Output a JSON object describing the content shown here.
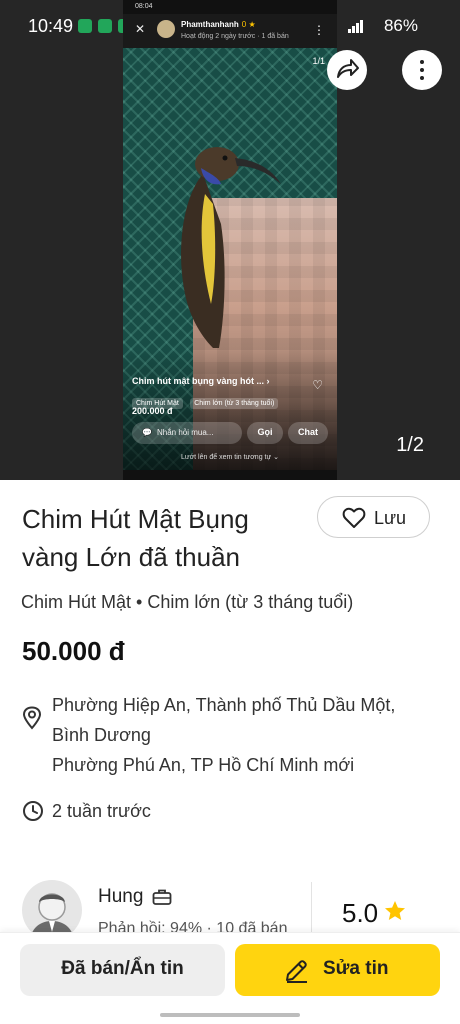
{
  "status_bar": {
    "time": "10:49",
    "battery": "86%"
  },
  "media": {
    "counter": "1/2",
    "embedded_screenshot": {
      "status_time": "08:04",
      "seller_name": "Phamthanhanh",
      "seller_rating": "0 ★",
      "seller_activity": "Hoạt động 2 ngày trước · 1 đã bán",
      "photo_counter": "1/1",
      "listing_title": "Chim hút mật bụng vàng hót ...",
      "tags": [
        "Chim Hút Mật",
        "Chim lớn (từ 3 tháng tuổi)"
      ],
      "price": "200.000 đ",
      "ask_placeholder": "Nhắn hỏi mua...",
      "call_label": "Gọi",
      "chat_label": "Chat",
      "swipe_hint": "Lướt lên để xem tin tương tự ⌄"
    }
  },
  "listing": {
    "title": "Chim Hút Mật Bụng vàng Lớn đã thuần",
    "save_label": "Lưu",
    "category": "Chim Hút Mật • Chim lớn (từ 3 tháng tuổi)",
    "price": "50.000 đ",
    "address_primary": "Phường Hiệp An, Thành phố Thủ Dầu Một, Bình Dương",
    "address_secondary": "Phường Phú An, TP Hồ Chí Minh mới",
    "posted": "2 tuần trước"
  },
  "seller": {
    "name": "Hung",
    "stats": "Phản hồi: 94% · 10 đã bán",
    "rating": "5.0"
  },
  "actions": {
    "sold_label": "Đã bán/Ẩn tin",
    "edit_label": "Sửa tin"
  },
  "colors": {
    "accent": "#ffd40f",
    "star": "#ffc400",
    "media_bg": "#262626"
  },
  "icons": [
    "share-icon",
    "more-vert-icon",
    "heart-icon",
    "location-pin-icon",
    "clock-icon",
    "briefcase-icon",
    "star-icon",
    "pencil-icon"
  ]
}
